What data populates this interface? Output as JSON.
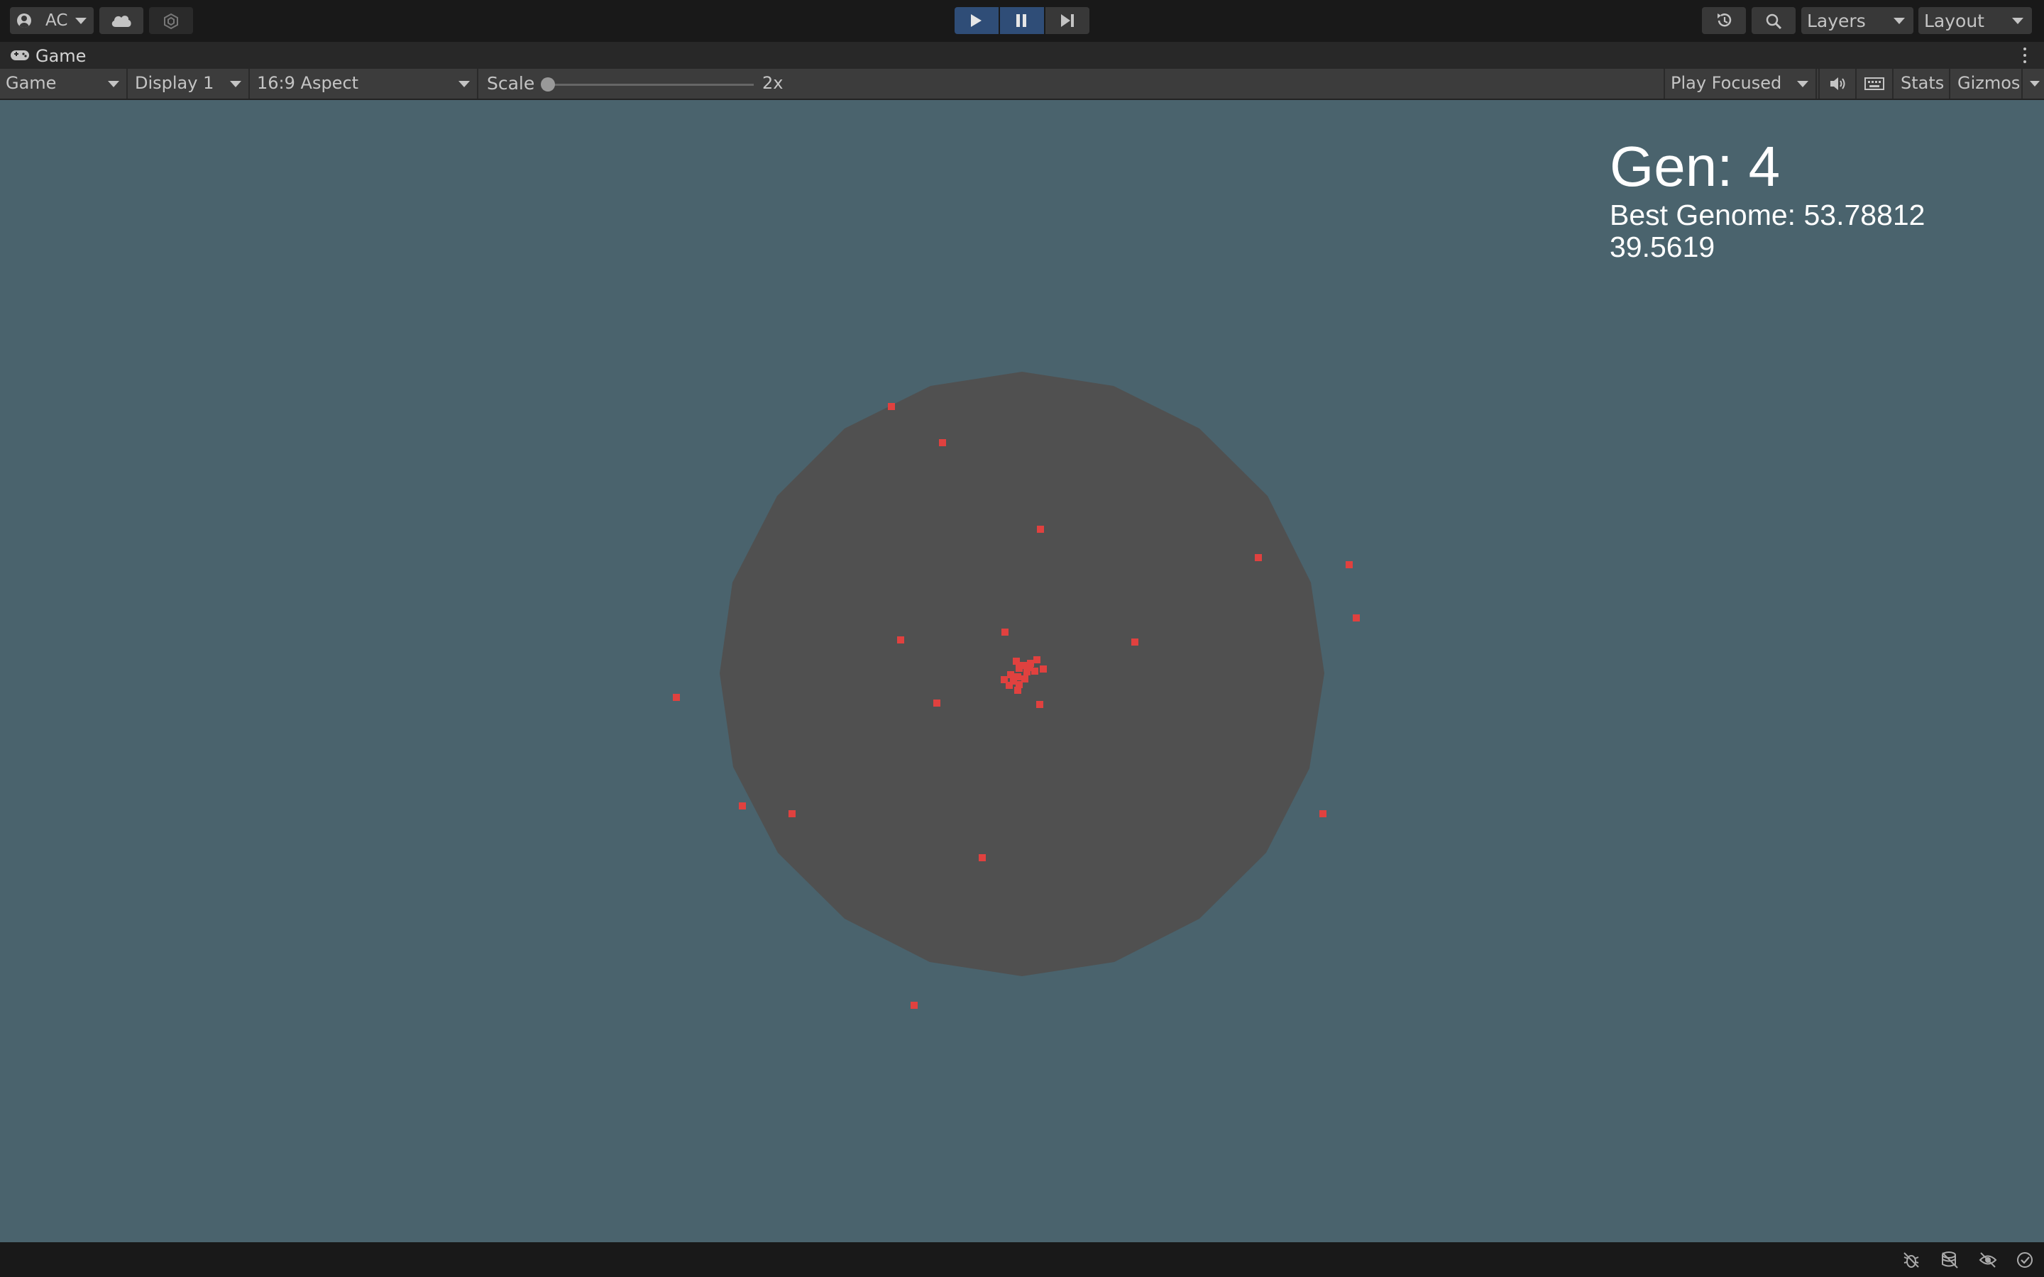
{
  "toolbar": {
    "account_label": "AC",
    "icons": [
      "account-icon",
      "cloud-icon",
      "collab-icon",
      "play-icon",
      "pause-icon",
      "step-icon",
      "history-icon",
      "search-icon"
    ],
    "layers_label": "Layers",
    "layout_label": "Layout",
    "play_state_color": "#2f4d77"
  },
  "tab": {
    "title": "Game",
    "icon": "gamepad-icon"
  },
  "controls": {
    "view_mode": "Game",
    "display": "Display 1",
    "aspect": "16:9 Aspect",
    "scale_label": "Scale",
    "scale_value": "2x",
    "scale_slider_fraction": 0.0,
    "play_mode": "Play Focused",
    "stats_label": "Stats",
    "gizmos_label": "Gizmos"
  },
  "game": {
    "background_color": "#4a636d",
    "arena_color": "#505050",
    "agent_color": "#e0413f",
    "hud": {
      "generation": "Gen: 4",
      "best_genome": "Best Genome: 53.78812",
      "current_fitness": "39.5619"
    }
  },
  "status_bar": {
    "icons": [
      "debug-icon",
      "cache-icon",
      "visibility-icon",
      "check-circle-icon"
    ]
  }
}
